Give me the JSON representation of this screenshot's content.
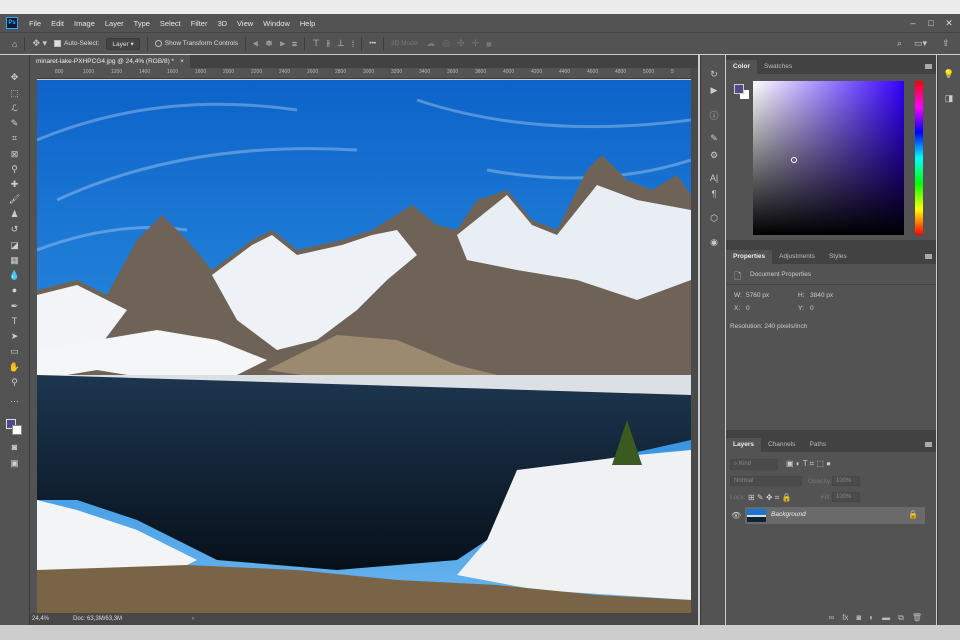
{
  "menu": {
    "logo": "Ps",
    "items": [
      "File",
      "Edit",
      "Image",
      "Layer",
      "Type",
      "Select",
      "Filter",
      "3D",
      "View",
      "Window",
      "Help"
    ]
  },
  "window_controls": {
    "minimize": "‒",
    "maximize": "□",
    "close": "✕"
  },
  "options": {
    "auto_select_label": "Auto-Select:",
    "auto_select_value": "Layer",
    "show_transform_label": "Show Transform Controls",
    "more": "•••",
    "mode_3d_label": "3D Mode:"
  },
  "document": {
    "tab_title": "minaret-lake-PXHPCG4.jpg @ 24,4% (RGB/8) *",
    "close": "×"
  },
  "ruler": {
    "ticks": [
      "800",
      "1000",
      "1200",
      "1400",
      "1600",
      "1800",
      "2000",
      "2200",
      "2400",
      "2600",
      "2800",
      "3000",
      "3200",
      "3400",
      "3600",
      "3800",
      "4000",
      "4200",
      "4400",
      "4600",
      "4800",
      "5000",
      "5"
    ]
  },
  "status": {
    "zoom": "24,4%",
    "doc": "Doc: 63,3M/63,3M"
  },
  "color_panel": {
    "tabs": [
      "Color",
      "Swatches"
    ],
    "foreground": "#4d4a8a",
    "hue_base": "#3300ff"
  },
  "properties_panel": {
    "tabs": [
      "Properties",
      "Adjustments",
      "Styles"
    ],
    "section": "Document Properties",
    "w_label": "W:",
    "w": "5760 px",
    "h_label": "H:",
    "h": "3840 px",
    "x_label": "X:",
    "x": "0",
    "y_label": "Y:",
    "y": "0",
    "resolution": "Resolution: 240 pixels/inch"
  },
  "layers_panel": {
    "tabs": [
      "Layers",
      "Channels",
      "Paths"
    ],
    "kind_placeholder": "Kind",
    "blend_mode": "Normal",
    "opacity_label": "Opacity:",
    "opacity": "100%",
    "lock_label": "Lock:",
    "fill_label": "Fill:",
    "fill": "100%",
    "layers": [
      {
        "name": "Background",
        "visible": true,
        "locked": true
      }
    ]
  },
  "layers_footer": [
    "link",
    "fx",
    "mask",
    "adjustment",
    "group",
    "new-layer",
    "delete"
  ]
}
